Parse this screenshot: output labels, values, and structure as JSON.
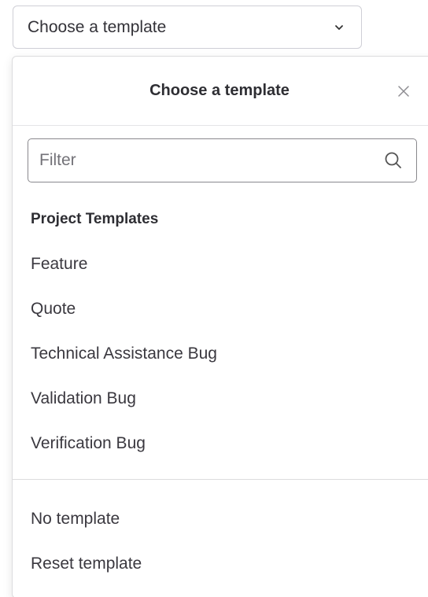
{
  "trigger": {
    "label": "Choose a template",
    "icon": "chevron-down-icon"
  },
  "dropdown": {
    "title": "Choose a template",
    "close_icon": "close-icon",
    "filter": {
      "placeholder": "Filter",
      "value": "",
      "icon": "search-icon"
    },
    "section_title": "Project Templates",
    "templates": [
      {
        "label": "Feature"
      },
      {
        "label": "Quote"
      },
      {
        "label": "Technical Assistance Bug"
      },
      {
        "label": "Validation Bug"
      },
      {
        "label": "Verification Bug"
      }
    ],
    "actions": [
      {
        "label": "No template"
      },
      {
        "label": "Reset template"
      }
    ]
  },
  "colors": {
    "border": "#cfcfd6",
    "text": "#333238",
    "muted": "#737278"
  }
}
